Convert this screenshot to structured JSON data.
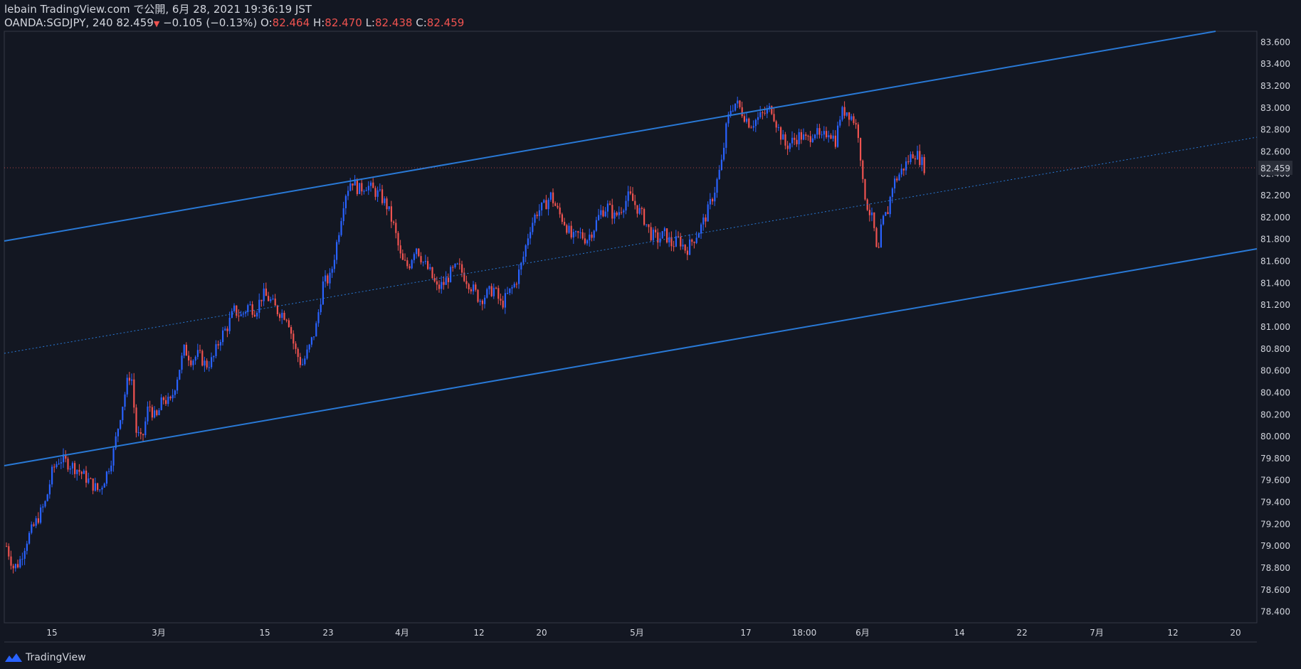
{
  "header": {
    "line1": "lebain TradingView.com で公開, 6月 28, 2021 19:36:19 JST",
    "symbol": "OANDA:SGDJPY, 240",
    "last": "82.459",
    "change": "−0.105 (−0.13%)",
    "o_label": "O:",
    "o_value": "82.464",
    "h_label": "H:",
    "h_value": "82.470",
    "l_label": "L:",
    "l_value": "82.438",
    "c_label": "C:",
    "c_value": "82.459"
  },
  "footer": {
    "brand": "TradingView"
  },
  "colors": {
    "up": "#2962ff",
    "down": "#ef5350",
    "channel": "#2979d6",
    "bg": "#131722"
  },
  "chart_data": {
    "type": "candlestick",
    "ylim": [
      78.3,
      83.7
    ],
    "yticks": [
      "83.600",
      "83.400",
      "83.200",
      "83.000",
      "82.800",
      "82.600",
      "82.400",
      "82.200",
      "82.000",
      "81.800",
      "81.600",
      "81.400",
      "81.200",
      "81.000",
      "80.800",
      "80.600",
      "80.400",
      "80.200",
      "80.000",
      "79.800",
      "79.600",
      "79.400",
      "79.200",
      "79.000",
      "78.800",
      "78.600",
      "78.400"
    ],
    "xticks": [
      "15",
      "3月",
      "15",
      "23",
      "4月",
      "12",
      "20",
      "5月",
      "17",
      "18:00",
      "6月",
      "14",
      "22",
      "7月",
      "12",
      "20"
    ],
    "last_price": "82.459",
    "close_path": [
      [
        0,
        79.0
      ],
      [
        10,
        78.8
      ],
      [
        18,
        78.85
      ],
      [
        28,
        79.05
      ],
      [
        40,
        79.2
      ],
      [
        55,
        79.4
      ],
      [
        65,
        79.7
      ],
      [
        75,
        79.8
      ],
      [
        88,
        79.75
      ],
      [
        100,
        79.7
      ],
      [
        115,
        79.6
      ],
      [
        130,
        79.5
      ],
      [
        140,
        79.65
      ],
      [
        150,
        79.85
      ],
      [
        160,
        80.2
      ],
      [
        170,
        80.5
      ],
      [
        175,
        80.6
      ],
      [
        182,
        80.05
      ],
      [
        190,
        79.95
      ],
      [
        200,
        80.3
      ],
      [
        210,
        80.15
      ],
      [
        220,
        80.35
      ],
      [
        230,
        80.3
      ],
      [
        240,
        80.55
      ],
      [
        250,
        80.8
      ],
      [
        260,
        80.7
      ],
      [
        270,
        80.75
      ],
      [
        280,
        80.65
      ],
      [
        290,
        80.7
      ],
      [
        300,
        80.9
      ],
      [
        310,
        81.0
      ],
      [
        320,
        81.15
      ],
      [
        330,
        81.1
      ],
      [
        340,
        81.2
      ],
      [
        350,
        81.15
      ],
      [
        360,
        81.3
      ],
      [
        370,
        81.25
      ],
      [
        380,
        81.15
      ],
      [
        395,
        81.1
      ],
      [
        405,
        80.8
      ],
      [
        415,
        80.65
      ],
      [
        425,
        80.8
      ],
      [
        435,
        81.0
      ],
      [
        445,
        81.4
      ],
      [
        455,
        81.45
      ],
      [
        465,
        81.8
      ],
      [
        475,
        82.2
      ],
      [
        485,
        82.35
      ],
      [
        495,
        82.25
      ],
      [
        505,
        82.3
      ],
      [
        515,
        82.25
      ],
      [
        525,
        82.2
      ],
      [
        535,
        82.1
      ],
      [
        545,
        81.9
      ],
      [
        555,
        81.6
      ],
      [
        565,
        81.55
      ],
      [
        575,
        81.75
      ],
      [
        585,
        81.6
      ],
      [
        595,
        81.5
      ],
      [
        605,
        81.35
      ],
      [
        615,
        81.4
      ],
      [
        625,
        81.5
      ],
      [
        635,
        81.55
      ],
      [
        645,
        81.45
      ],
      [
        655,
        81.35
      ],
      [
        665,
        81.25
      ],
      [
        675,
        81.3
      ],
      [
        685,
        81.35
      ],
      [
        695,
        81.2
      ],
      [
        705,
        81.3
      ],
      [
        715,
        81.4
      ],
      [
        725,
        81.6
      ],
      [
        735,
        81.9
      ],
      [
        745,
        82.05
      ],
      [
        755,
        82.1
      ],
      [
        765,
        82.2
      ],
      [
        775,
        82.05
      ],
      [
        785,
        81.95
      ],
      [
        795,
        81.8
      ],
      [
        805,
        81.85
      ],
      [
        815,
        81.8
      ],
      [
        825,
        81.9
      ],
      [
        835,
        82.05
      ],
      [
        845,
        82.1
      ],
      [
        855,
        82.0
      ],
      [
        865,
        82.1
      ],
      [
        875,
        82.2
      ],
      [
        885,
        82.1
      ],
      [
        895,
        82.0
      ],
      [
        905,
        81.85
      ],
      [
        915,
        81.8
      ],
      [
        925,
        81.85
      ],
      [
        935,
        81.75
      ],
      [
        945,
        81.8
      ],
      [
        955,
        81.7
      ],
      [
        965,
        81.8
      ],
      [
        975,
        81.9
      ],
      [
        985,
        82.05
      ],
      [
        995,
        82.25
      ],
      [
        1005,
        82.5
      ],
      [
        1012,
        82.85
      ],
      [
        1018,
        83.0
      ],
      [
        1025,
        83.05
      ],
      [
        1035,
        82.95
      ],
      [
        1045,
        82.85
      ],
      [
        1055,
        82.9
      ],
      [
        1065,
        82.95
      ],
      [
        1075,
        83.0
      ],
      [
        1085,
        82.8
      ],
      [
        1095,
        82.65
      ],
      [
        1105,
        82.7
      ],
      [
        1115,
        82.75
      ],
      [
        1125,
        82.7
      ],
      [
        1135,
        82.8
      ],
      [
        1145,
        82.7
      ],
      [
        1155,
        82.8
      ],
      [
        1165,
        82.7
      ],
      [
        1172,
        82.95
      ],
      [
        1180,
        82.98
      ],
      [
        1190,
        82.9
      ],
      [
        1198,
        82.75
      ],
      [
        1203,
        82.3
      ],
      [
        1210,
        82.1
      ],
      [
        1218,
        81.95
      ],
      [
        1224,
        81.6
      ],
      [
        1230,
        81.95
      ],
      [
        1238,
        82.05
      ],
      [
        1245,
        82.3
      ],
      [
        1255,
        82.4
      ],
      [
        1265,
        82.5
      ],
      [
        1275,
        82.6
      ],
      [
        1282,
        82.55
      ],
      [
        1290,
        82.46
      ]
    ]
  }
}
